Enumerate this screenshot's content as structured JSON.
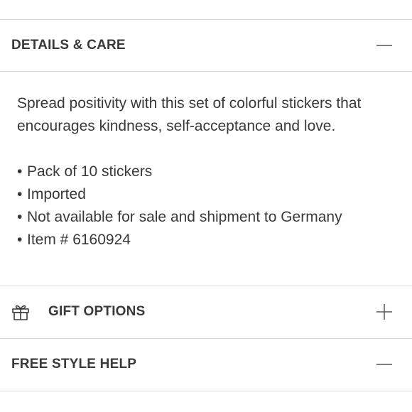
{
  "sections": {
    "details": {
      "title": "DETAILS & CARE",
      "state": "expanded",
      "description": "Spread positivity with this set of colorful stickers that encourages kindness, self-acceptance and love.",
      "bullets": [
        "Pack of 10 stickers",
        "Imported",
        "Not available for sale and shipment to Germany",
        "Item # 6160924"
      ]
    },
    "gift": {
      "title": "GIFT OPTIONS",
      "state": "collapsed",
      "icon": "gift-icon"
    },
    "style_help": {
      "title": "FREE STYLE HELP",
      "state": "expanded"
    }
  },
  "icons": {
    "expanded": "minus-icon",
    "collapsed": "plus-icon"
  },
  "colors": {
    "text": "#393939",
    "divider": "#d6d6d6",
    "icon": "#555555"
  }
}
